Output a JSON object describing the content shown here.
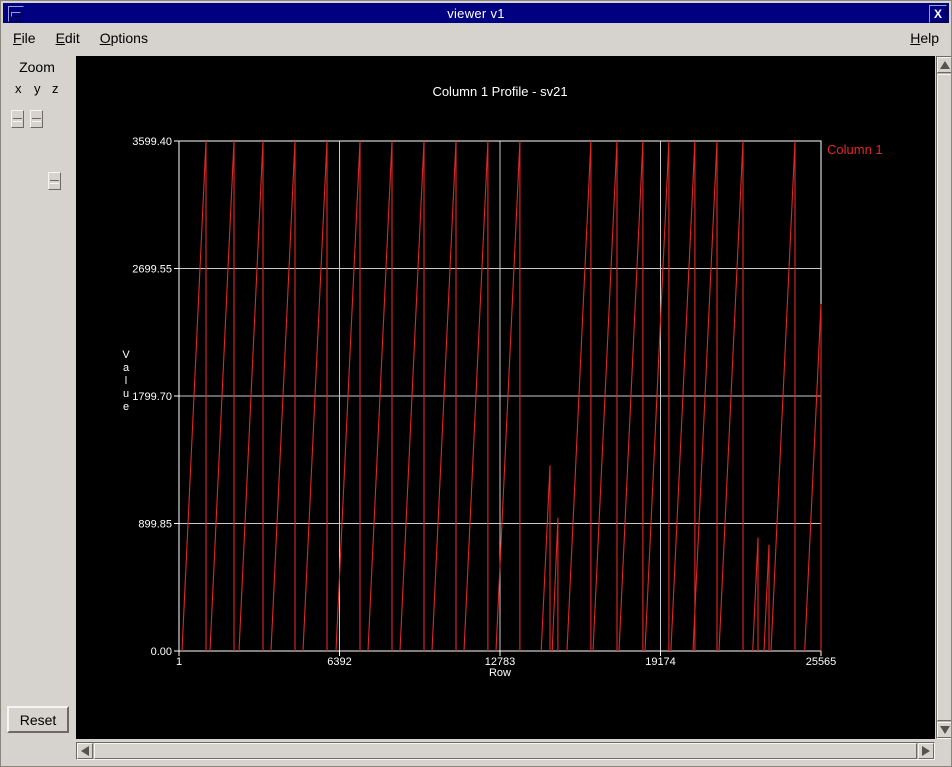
{
  "window": {
    "title": "viewer v1",
    "close_glyph": "X"
  },
  "menubar": {
    "items": [
      {
        "label": "File",
        "mnemonic_index": 0
      },
      {
        "label": "Edit",
        "mnemonic_index": 0
      },
      {
        "label": "Options",
        "mnemonic_index": 0
      }
    ],
    "help": {
      "label": "Help",
      "mnemonic_index": 0
    }
  },
  "zoom_panel": {
    "title": "Zoom",
    "sliders": [
      {
        "axis": "x",
        "value": 0
      },
      {
        "axis": "y",
        "value": 0
      },
      {
        "axis": "z",
        "value": 0.12
      }
    ],
    "reset_label": "Reset"
  },
  "colors": {
    "titlebar": "#000080",
    "chrome": "#d6d3ce",
    "plot_background": "#000000",
    "axis": "#ffffff",
    "grid": "#c8c8c8",
    "series": "#e02828"
  },
  "chart_data": {
    "type": "line",
    "title": "Column 1 Profile - sv21",
    "xlabel": "Row",
    "ylabel": "Value",
    "grid": true,
    "legend_position": "top-right-outside",
    "xlim": [
      1,
      25565
    ],
    "ylim": [
      0.0,
      3599.4
    ],
    "x_ticks": [
      1,
      6392,
      12783,
      19174,
      25565
    ],
    "x_tick_labels": [
      "1",
      "6392",
      "12783",
      "19174",
      "25565"
    ],
    "y_ticks": [
      0.0,
      899.85,
      1799.7,
      2699.55,
      3599.4
    ],
    "y_tick_labels": [
      "0.00",
      "899.85",
      "1799.70",
      "2699.55",
      "3599.40"
    ],
    "series": [
      {
        "name": "Column 1",
        "color": "#e02828",
        "shape": "sawtooth",
        "ramps": [
          [
            120,
            1075,
            0,
            3599.4
          ],
          [
            1235,
            2190,
            0,
            3599.4
          ],
          [
            2390,
            3345,
            0,
            3599.4
          ],
          [
            3664,
            4619,
            0,
            3599.4
          ],
          [
            4938,
            5893,
            0,
            3599.4
          ],
          [
            6252,
            7207,
            0,
            3599.4
          ],
          [
            7526,
            8481,
            0,
            3599.4
          ],
          [
            8800,
            9755,
            0,
            3599.4
          ],
          [
            10074,
            11029,
            0,
            3599.4
          ],
          [
            11348,
            12303,
            0,
            3599.4
          ],
          [
            12622,
            13577,
            0,
            3599.4
          ],
          [
            14424,
            14772,
            0,
            1310
          ],
          [
            14860,
            15090,
            0,
            940
          ],
          [
            15449,
            16404,
            0,
            3599.4
          ],
          [
            16485,
            17440,
            0,
            3599.4
          ],
          [
            17520,
            18475,
            0,
            3599.4
          ],
          [
            18555,
            19510,
            0,
            3599.4
          ],
          [
            19590,
            20545,
            0,
            3599.4
          ],
          [
            20468,
            21423,
            0,
            3599.4
          ],
          [
            21503,
            22458,
            0,
            3599.4
          ],
          [
            22844,
            23056,
            0,
            800
          ],
          [
            23295,
            23494,
            0,
            750
          ],
          [
            23574,
            24529,
            0,
            3599.4
          ],
          [
            24915,
            25565,
            0,
            2450
          ]
        ]
      }
    ]
  }
}
